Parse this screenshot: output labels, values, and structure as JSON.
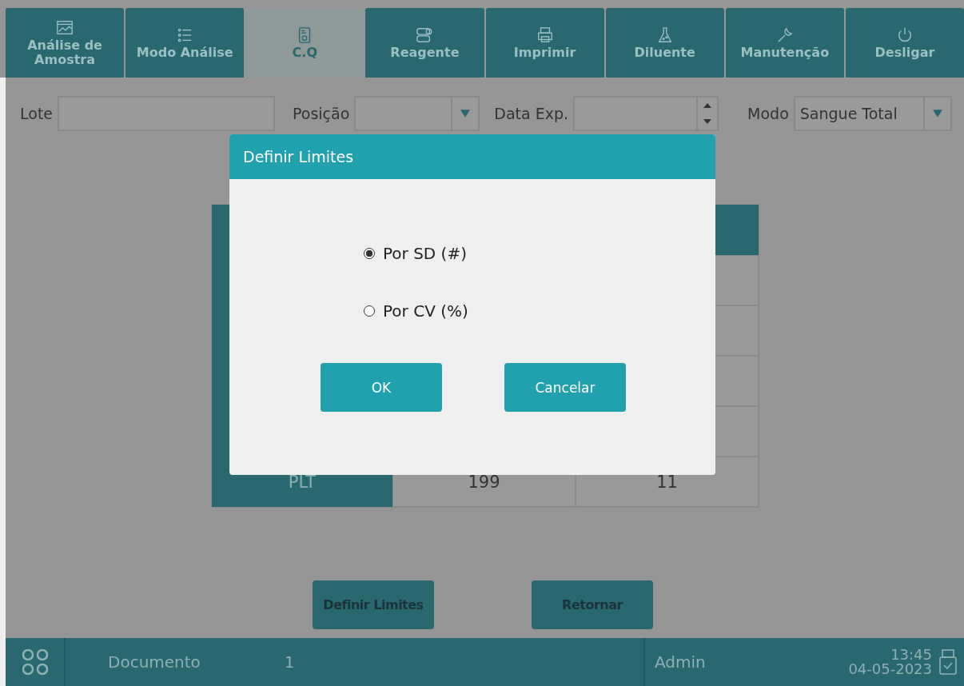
{
  "tabs": [
    {
      "label": "Análise de Amostra",
      "selected": false
    },
    {
      "label": "Modo Análise",
      "selected": false
    },
    {
      "label": "C.Q",
      "selected": true
    },
    {
      "label": "Reagente",
      "selected": false
    },
    {
      "label": "Imprimir",
      "selected": false
    },
    {
      "label": "Diluente",
      "selected": false
    },
    {
      "label": "Manutenção",
      "selected": false
    },
    {
      "label": "Desligar",
      "selected": false
    }
  ],
  "filters": {
    "lote_label": "Lote",
    "posicao_label": "Posição",
    "data_exp_label": "Data Exp.",
    "modo_label": "Modo",
    "modo_value": "Sangue Total"
  },
  "table": {
    "rows": [
      {
        "cells": [
          "PLT",
          "199",
          "11"
        ]
      }
    ]
  },
  "actions": [
    "Definir Limites",
    "Retornar"
  ],
  "dialog": {
    "title": "Definir Limites",
    "options": [
      {
        "label": "Por SD (#)",
        "selected": true
      },
      {
        "label": "Por CV (%)",
        "selected": false
      }
    ],
    "buttons": [
      "OK",
      "Cancelar"
    ]
  },
  "status_bar": {
    "document_label": "Documento",
    "document_value": "1",
    "user": "Admin",
    "time": "13:45",
    "date": "04-05-2023"
  }
}
